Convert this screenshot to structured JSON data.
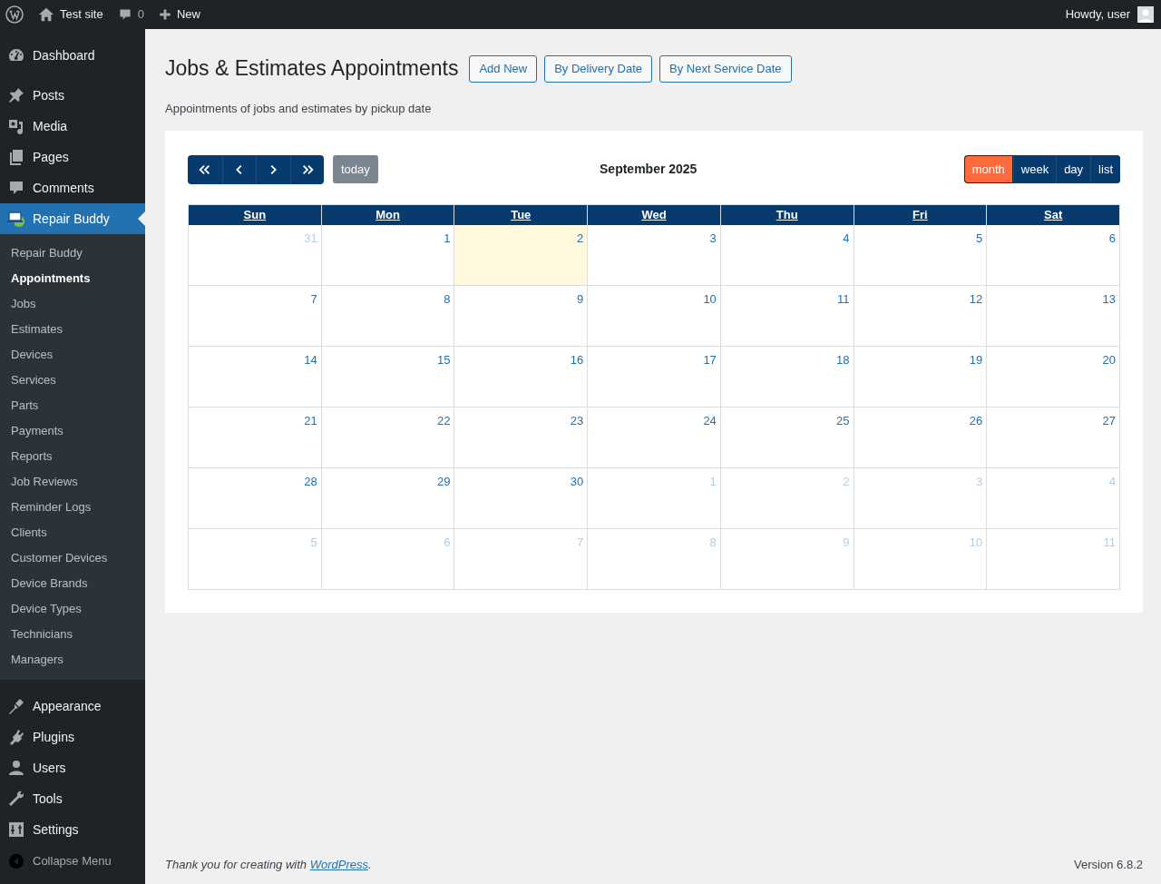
{
  "admin_bar": {
    "site": "Test site",
    "comments": "0",
    "new": "New",
    "greeting": "Howdy, user"
  },
  "sidebar": {
    "items": [
      {
        "label": "Dashboard",
        "selected": false
      },
      {
        "label": "Posts",
        "selected": false
      },
      {
        "label": "Media",
        "selected": false
      },
      {
        "label": "Pages",
        "selected": false
      },
      {
        "label": "Comments",
        "selected": false
      },
      {
        "label": "Repair Buddy",
        "selected": true,
        "children": [
          {
            "label": "Repair Buddy",
            "selected": false
          },
          {
            "label": "Appointments",
            "selected": true
          },
          {
            "label": "Jobs",
            "selected": false
          },
          {
            "label": "Estimates",
            "selected": false
          },
          {
            "label": "Devices",
            "selected": false
          },
          {
            "label": "Services",
            "selected": false
          },
          {
            "label": "Parts",
            "selected": false
          },
          {
            "label": "Payments",
            "selected": false
          },
          {
            "label": "Reports",
            "selected": false
          },
          {
            "label": "Job Reviews",
            "selected": false
          },
          {
            "label": "Reminder Logs",
            "selected": false
          },
          {
            "label": "Clients",
            "selected": false
          },
          {
            "label": "Customer Devices",
            "selected": false
          },
          {
            "label": "Device Brands",
            "selected": false
          },
          {
            "label": "Device Types",
            "selected": false
          },
          {
            "label": "Technicians",
            "selected": false
          },
          {
            "label": "Managers",
            "selected": false
          }
        ]
      },
      {
        "label": "Appearance",
        "selected": false
      },
      {
        "label": "Plugins",
        "selected": false
      },
      {
        "label": "Users",
        "selected": false
      },
      {
        "label": "Tools",
        "selected": false
      },
      {
        "label": "Settings",
        "selected": false
      }
    ],
    "collapse": "Collapse Menu"
  },
  "page": {
    "title": "Jobs & Estimates Appointments",
    "buttons": [
      "Add New",
      "By Delivery Date",
      "By Next Service Date"
    ],
    "description": "Appointments of jobs and estimates by pickup date"
  },
  "calendar": {
    "today_button": "today",
    "title": "September 2025",
    "views": [
      {
        "label": "month",
        "selected": true
      },
      {
        "label": "week",
        "selected": false
      },
      {
        "label": "day",
        "selected": false
      },
      {
        "label": "list",
        "selected": false
      }
    ],
    "weekdays": [
      "Sun",
      "Mon",
      "Tue",
      "Wed",
      "Thu",
      "Fri",
      "Sat"
    ],
    "weeks": [
      [
        {
          "day": "31",
          "other_month": true
        },
        {
          "day": "1",
          "other_month": false
        },
        {
          "day": "2",
          "other_month": false,
          "today": true
        },
        {
          "day": "3",
          "other_month": false
        },
        {
          "day": "4",
          "other_month": false
        },
        {
          "day": "5",
          "other_month": false
        },
        {
          "day": "6",
          "other_month": false
        }
      ],
      [
        {
          "day": "7",
          "other_month": false
        },
        {
          "day": "8",
          "other_month": false
        },
        {
          "day": "9",
          "other_month": false
        },
        {
          "day": "10",
          "other_month": false
        },
        {
          "day": "11",
          "other_month": false
        },
        {
          "day": "12",
          "other_month": false
        },
        {
          "day": "13",
          "other_month": false
        }
      ],
      [
        {
          "day": "14",
          "other_month": false
        },
        {
          "day": "15",
          "other_month": false
        },
        {
          "day": "16",
          "other_month": false
        },
        {
          "day": "17",
          "other_month": false
        },
        {
          "day": "18",
          "other_month": false
        },
        {
          "day": "19",
          "other_month": false
        },
        {
          "day": "20",
          "other_month": false
        }
      ],
      [
        {
          "day": "21",
          "other_month": false
        },
        {
          "day": "22",
          "other_month": false
        },
        {
          "day": "23",
          "other_month": false
        },
        {
          "day": "24",
          "other_month": false
        },
        {
          "day": "25",
          "other_month": false
        },
        {
          "day": "26",
          "other_month": false
        },
        {
          "day": "27",
          "other_month": false
        }
      ],
      [
        {
          "day": "28",
          "other_month": false
        },
        {
          "day": "29",
          "other_month": false
        },
        {
          "day": "30",
          "other_month": false
        },
        {
          "day": "1",
          "other_month": true
        },
        {
          "day": "2",
          "other_month": true
        },
        {
          "day": "3",
          "other_month": true
        },
        {
          "day": "4",
          "other_month": true
        }
      ],
      [
        {
          "day": "5",
          "other_month": true
        },
        {
          "day": "6",
          "other_month": true
        },
        {
          "day": "7",
          "other_month": true
        },
        {
          "day": "8",
          "other_month": true
        },
        {
          "day": "9",
          "other_month": true
        },
        {
          "day": "10",
          "other_month": true
        },
        {
          "day": "11",
          "other_month": true
        }
      ]
    ]
  },
  "footer": {
    "thanks_before": "Thank you for creating with ",
    "link": "WordPress",
    "thanks_after": ".",
    "version": "Version 6.8.2"
  }
}
